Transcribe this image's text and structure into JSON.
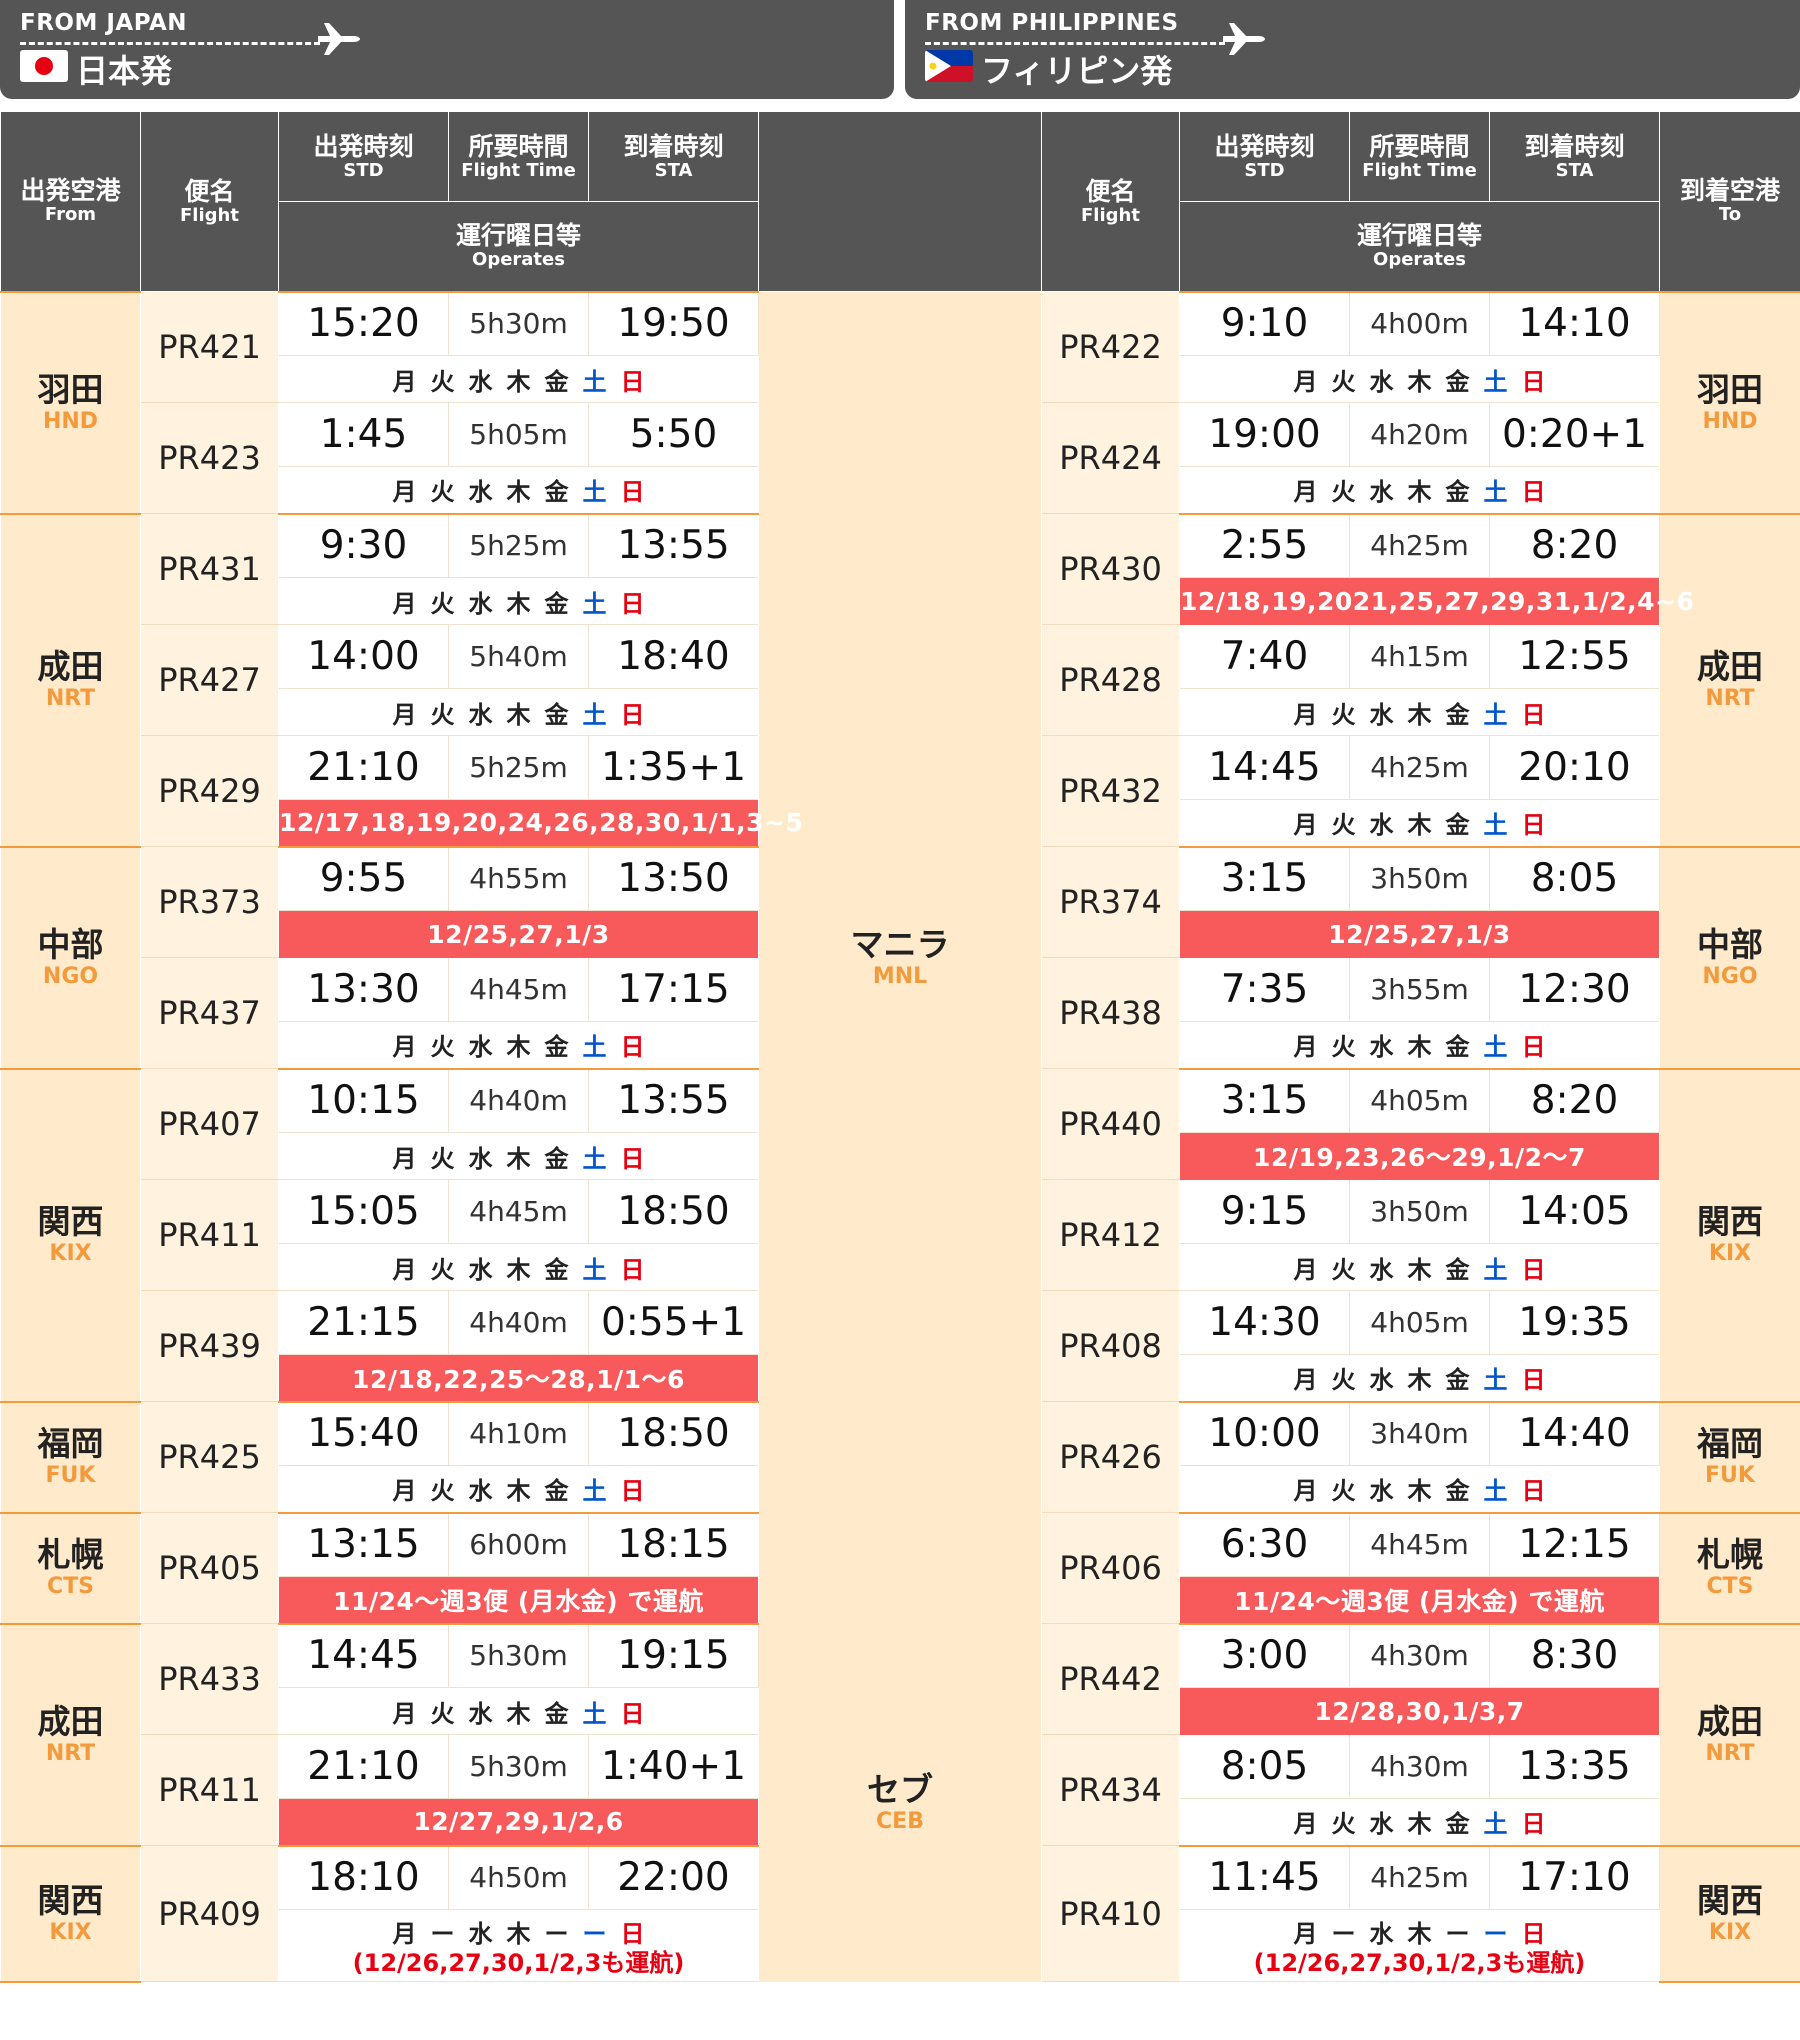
{
  "banners": {
    "left": {
      "en": "FROM JAPAN",
      "jp": "日本発"
    },
    "right": {
      "en": "FROM PHILIPPINES",
      "jp": "フィリピン発"
    }
  },
  "headers": {
    "from": {
      "jp": "出発空港",
      "en": "From"
    },
    "flight": {
      "jp": "便名",
      "en": "Flight"
    },
    "std": {
      "jp": "出発時刻",
      "en": "STD"
    },
    "duration": {
      "jp": "所要時間",
      "en": "Flight Time"
    },
    "sta": {
      "jp": "到着時刻",
      "en": "STA"
    },
    "operates": {
      "jp": "運行曜日等",
      "en": "Operates"
    },
    "to": {
      "jp": "到着空港",
      "en": "To"
    }
  },
  "days": [
    "月",
    "火",
    "水",
    "木",
    "金",
    "土",
    "日"
  ],
  "days_partial": [
    "月",
    "ー",
    "水",
    "木",
    "ー",
    "ー",
    "日"
  ],
  "hubs": {
    "mnl": {
      "jp": "マニラ",
      "code": "MNL"
    },
    "ceb": {
      "jp": "セブ",
      "code": "CEB"
    }
  },
  "airports": {
    "hnd": {
      "jp": "羽田",
      "code": "HND"
    },
    "nrt": {
      "jp": "成田",
      "code": "NRT"
    },
    "ngo": {
      "jp": "中部",
      "code": "NGO"
    },
    "kix": {
      "jp": "関西",
      "code": "KIX"
    },
    "fuk": {
      "jp": "福岡",
      "code": "FUK"
    },
    "cts": {
      "jp": "札幌",
      "code": "CTS"
    },
    "nrt2": {
      "jp": "成田",
      "code": "NRT"
    },
    "kix2": {
      "jp": "関西",
      "code": "KIX"
    }
  },
  "rows": [
    {
      "l": {
        "fl": "PR421",
        "std": "15:20",
        "dur": "5h30m",
        "sta": "19:50"
      },
      "r": {
        "fl": "PR422",
        "std": "9:10",
        "dur": "4h00m",
        "sta": "14:10"
      }
    },
    {
      "l": {
        "fl": "PR423",
        "std": "1:45",
        "dur": "5h05m",
        "sta": "5:50"
      },
      "r": {
        "fl": "PR424",
        "std": "19:00",
        "dur": "4h20m",
        "sta": "0:20+1"
      }
    },
    {
      "l": {
        "fl": "PR431",
        "std": "9:30",
        "dur": "5h25m",
        "sta": "13:55"
      },
      "r": {
        "fl": "PR430",
        "std": "2:55",
        "dur": "4h25m",
        "sta": "8:20",
        "note": "12/18,19,2021,25,27,29,31,1/2,4~6"
      }
    },
    {
      "l": {
        "fl": "PR427",
        "std": "14:00",
        "dur": "5h40m",
        "sta": "18:40"
      },
      "r": {
        "fl": "PR428",
        "std": "7:40",
        "dur": "4h15m",
        "sta": "12:55"
      }
    },
    {
      "l": {
        "fl": "PR429",
        "std": "21:10",
        "dur": "5h25m",
        "sta": "1:35+1",
        "note": "12/17,18,19,20,24,26,28,30,1/1,3~5"
      },
      "r": {
        "fl": "PR432",
        "std": "14:45",
        "dur": "4h25m",
        "sta": "20:10"
      }
    },
    {
      "l": {
        "fl": "PR373",
        "std": "9:55",
        "dur": "4h55m",
        "sta": "13:50",
        "note": "12/25,27,1/3"
      },
      "r": {
        "fl": "PR374",
        "std": "3:15",
        "dur": "3h50m",
        "sta": "8:05",
        "note": "12/25,27,1/3"
      }
    },
    {
      "l": {
        "fl": "PR437",
        "std": "13:30",
        "dur": "4h45m",
        "sta": "17:15"
      },
      "r": {
        "fl": "PR438",
        "std": "7:35",
        "dur": "3h55m",
        "sta": "12:30"
      }
    },
    {
      "l": {
        "fl": "PR407",
        "std": "10:15",
        "dur": "4h40m",
        "sta": "13:55"
      },
      "r": {
        "fl": "PR440",
        "std": "3:15",
        "dur": "4h05m",
        "sta": "8:20",
        "note": "12/19,23,26〜29,1/2〜7"
      }
    },
    {
      "l": {
        "fl": "PR411",
        "std": "15:05",
        "dur": "4h45m",
        "sta": "18:50"
      },
      "r": {
        "fl": "PR412",
        "std": "9:15",
        "dur": "3h50m",
        "sta": "14:05"
      }
    },
    {
      "l": {
        "fl": "PR439",
        "std": "21:15",
        "dur": "4h40m",
        "sta": "0:55+1",
        "note": "12/18,22,25〜28,1/1〜6"
      },
      "r": {
        "fl": "PR408",
        "std": "14:30",
        "dur": "4h05m",
        "sta": "19:35"
      }
    },
    {
      "l": {
        "fl": "PR425",
        "std": "15:40",
        "dur": "4h10m",
        "sta": "18:50"
      },
      "r": {
        "fl": "PR426",
        "std": "10:00",
        "dur": "3h40m",
        "sta": "14:40"
      }
    },
    {
      "l": {
        "fl": "PR405",
        "std": "13:15",
        "dur": "6h00m",
        "sta": "18:15",
        "note": "11/24〜週3便 (月水金) で運航"
      },
      "r": {
        "fl": "PR406",
        "std": "6:30",
        "dur": "4h45m",
        "sta": "12:15",
        "note": "11/24〜週3便 (月水金) で運航"
      }
    },
    {
      "l": {
        "fl": "PR433",
        "std": "14:45",
        "dur": "5h30m",
        "sta": "19:15"
      },
      "r": {
        "fl": "PR442",
        "std": "3:00",
        "dur": "4h30m",
        "sta": "8:30",
        "note": "12/28,30,1/3,7"
      }
    },
    {
      "l": {
        "fl": "PR411",
        "std": "21:10",
        "dur": "5h30m",
        "sta": "1:40+1",
        "note": "12/27,29,1/2,6"
      },
      "r": {
        "fl": "PR434",
        "std": "8:05",
        "dur": "4h30m",
        "sta": "13:35"
      }
    },
    {
      "l": {
        "fl": "PR409",
        "std": "18:10",
        "dur": "4h50m",
        "sta": "22:00",
        "extra": "(12/26,27,30,1/2,3も運航)"
      },
      "r": {
        "fl": "PR410",
        "std": "11:45",
        "dur": "4h25m",
        "sta": "17:10",
        "extra": "(12/26,27,30,1/2,3も運航)"
      }
    }
  ],
  "colors": {
    "header_bg": "#555555",
    "airport_bg": "#ffebcc",
    "accent_orange": "#f39a3c",
    "note_red": "#f8595a",
    "sat_blue": "#0055cc",
    "sun_red": "#e60012"
  }
}
